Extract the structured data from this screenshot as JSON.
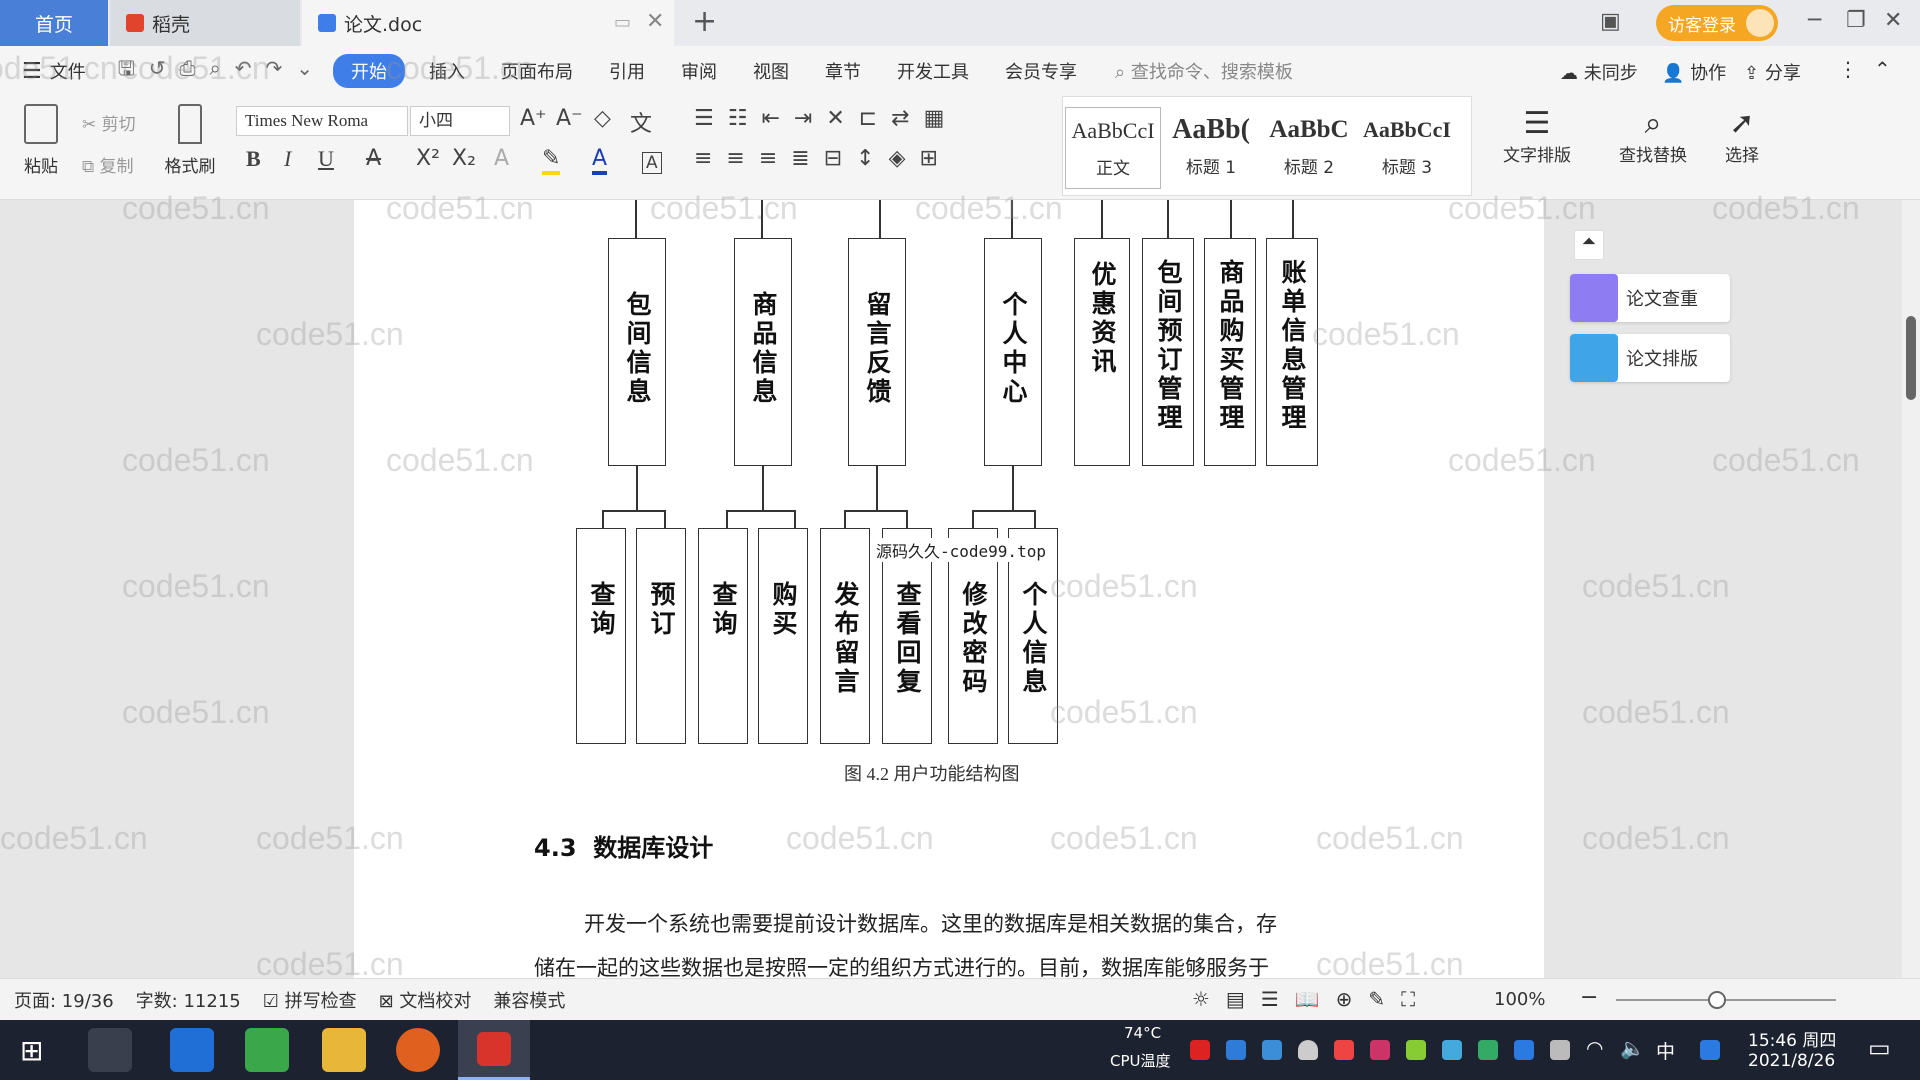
{
  "tabs": {
    "home": "首页",
    "daoke": "稻壳",
    "doc": "论文.doc"
  },
  "title_right": {
    "login": "访客登录"
  },
  "menu": {
    "file": "文件",
    "items": [
      "开始",
      "插入",
      "页面布局",
      "引用",
      "审阅",
      "视图",
      "章节",
      "开发工具",
      "会员专享"
    ],
    "search_placeholder": "查找命令、搜索模板",
    "sync": "未同步",
    "collab": "协作",
    "share": "分享"
  },
  "ribbon": {
    "paste": "粘贴",
    "cut": "剪切",
    "copy": "复制",
    "format_painter": "格式刷",
    "font": "Times New Roma",
    "size": "小四",
    "styles": [
      {
        "preview": "AaBbCcI",
        "name": "正文"
      },
      {
        "preview": "AaBb(",
        "name": "标题 1"
      },
      {
        "preview": "AaBbC",
        "name": "标题 2"
      },
      {
        "preview": "AaBbCcI",
        "name": "标题 3"
      }
    ],
    "text_layout": "文字排版",
    "find_replace": "查找替换",
    "select": "选择"
  },
  "diagram": {
    "top_row": [
      "包间信息",
      "商品信息",
      "留言反馈",
      "个人中心",
      "优惠资讯",
      "包间预订管理",
      "商品购买管理",
      "账单信息管理"
    ],
    "bottom_row": [
      "查询",
      "预订",
      "查询",
      "购买",
      "发布留言",
      "查看回复",
      "修改密码",
      "个人信息"
    ],
    "overlay": "源码久久-code99.top",
    "caption": "图 4.2  用户功能结构图"
  },
  "section": {
    "number": "4.3",
    "title": "数据库设计"
  },
  "body_text": [
    "开发一个系统也需要提前设计数据库。这里的数据库是相关数据的集合，存",
    "储在一起的这些数据也是按照一定的组织方式进行的。目前，数据库能够服务于"
  ],
  "watermark": "code51.cn",
  "side": {
    "check": "论文查重",
    "layout": "论文排版"
  },
  "status": {
    "page": "页面: 19/36",
    "words": "字数: 11215",
    "spell": "拼写检查",
    "proof": "文档校对",
    "compat": "兼容模式",
    "zoom": "100%"
  },
  "taskbar": {
    "temp": "74°C",
    "temp_label": "CPU温度",
    "ime": "中",
    "time": "15:46 周四",
    "date": "2021/8/26"
  },
  "colors": {
    "accent": "#3f7ee8",
    "login": "#f5a623"
  }
}
